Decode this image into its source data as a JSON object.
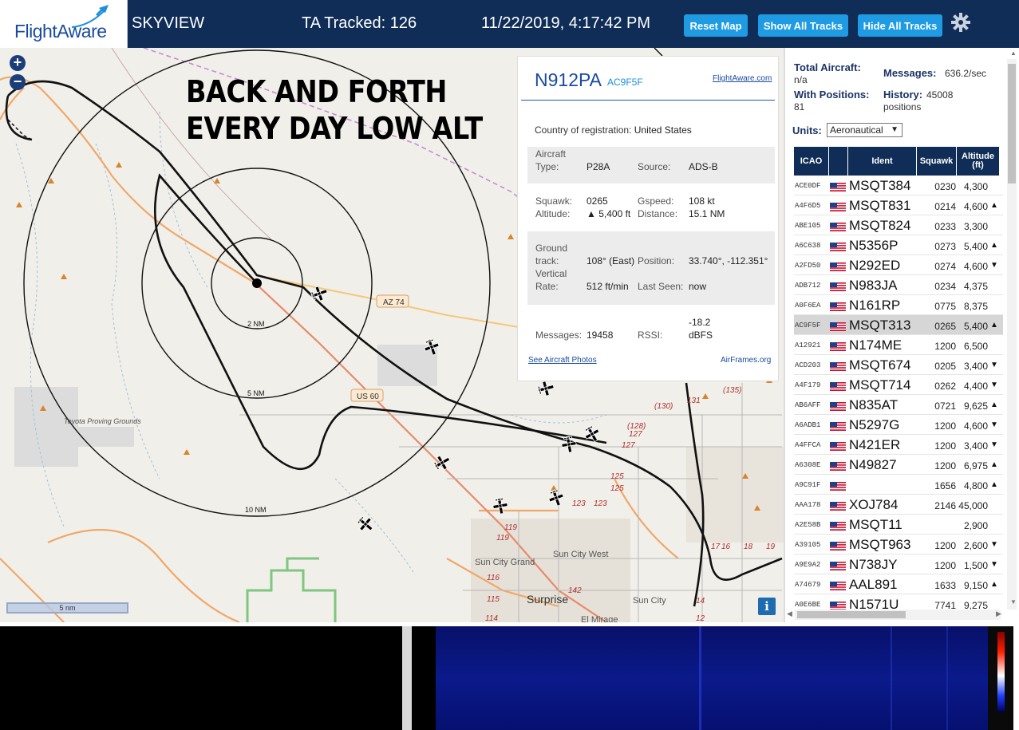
{
  "header": {
    "logo_text": "FlightAware",
    "app_name": "SKYVIEW",
    "tracked": "TA Tracked: 126",
    "datetime": "11/22/2019, 4:17:42 PM",
    "btn_reset": "Reset Map",
    "btn_show": "Show All Tracks",
    "btn_hide": "Hide All Tracks",
    "settings_icon": "gear-icon"
  },
  "map": {
    "overlay_line1": "BACK AND FORTH",
    "overlay_line2": "EVERY DAY LOW ALT",
    "zoom_in": "+",
    "zoom_out": "−",
    "scale_label": "5 nm",
    "info_label": "i",
    "ring_labels": [
      "2 NM",
      "5 NM",
      "10 NM"
    ],
    "road_labels": [
      "AZ 74",
      "US 60"
    ],
    "place_labels": {
      "toyota": "Toyota Proving Grounds",
      "sun_city_grand": "Sun City Grand",
      "sun_city_west": "Sun City West",
      "surprise": "Surprise",
      "sun_city": "Sun City",
      "el_mirage": "El Mirage"
    },
    "route_numbers": [
      "(130)",
      "131",
      "(135)",
      "(128)",
      "127",
      "127",
      "125",
      "125",
      "123",
      "123",
      "119",
      "119",
      "116",
      "115",
      "114",
      "142",
      "17",
      "16",
      "18",
      "19",
      "14",
      "12"
    ]
  },
  "popup": {
    "ident": "N912PA",
    "hex": "AC9F5F",
    "fa_link": "FlightAware.com",
    "country_label": "Country of registration:",
    "country_value": "United States",
    "aircraft_type_label_1": "Aircraft",
    "aircraft_type_label_2": "Type:",
    "aircraft_type": "P28A",
    "source_label": "Source:",
    "source": "ADS-B",
    "squawk_label": "Squawk:",
    "squawk": "0265",
    "gspeed_label": "Gspeed:",
    "gspeed": "108 kt",
    "altitude_label": "Altitude:",
    "altitude": "▲ 5,400 ft",
    "distance_label": "Distance:",
    "distance": "15.1 NM",
    "ground_label_1": "Ground",
    "ground_label_2": "track:",
    "ground_track": "108° (East)",
    "position_label": "Position:",
    "position": "33.740°, -112.351°",
    "vertical_label_1": "Vertical",
    "vertical_label_2": "Rate:",
    "vertical_rate": "512 ft/min",
    "last_seen_label": "Last Seen:",
    "last_seen": "now",
    "messages_label": "Messages:",
    "messages": "19458",
    "rssi_label": "RSSI:",
    "rssi_1": "-18.2",
    "rssi_2": "dBFS",
    "photos_link": "See Aircraft Photos",
    "airframes_link": "AirFrames.org"
  },
  "stats": {
    "total_label": "Total Aircraft:",
    "total_value": "n/a",
    "messages_label": "Messages:",
    "messages_value": "636.2/sec",
    "withpos_label": "With Positions:",
    "withpos_value": "81",
    "history_label": "History:",
    "history_value_1": "45008",
    "history_value_2": "positions",
    "units_label": "Units:",
    "units_value": "Aeronautical"
  },
  "table": {
    "headers": [
      "ICAO",
      "",
      "Ident",
      "Squawk",
      "Altitude (ft)"
    ],
    "rows": [
      {
        "icao": "ACE0DF",
        "ident": "MSQT384",
        "squawk": "0230",
        "alt": "4,300",
        "arrow": ""
      },
      {
        "icao": "A4F6D5",
        "ident": "MSQT831",
        "squawk": "0214",
        "alt": "4,600",
        "arrow": "▲"
      },
      {
        "icao": "ABE105",
        "ident": "MSQT824",
        "squawk": "0233",
        "alt": "3,300",
        "arrow": ""
      },
      {
        "icao": "A6C638",
        "ident": "N5356P",
        "squawk": "0273",
        "alt": "5,400",
        "arrow": "▲"
      },
      {
        "icao": "A2FD50",
        "ident": "N292ED",
        "squawk": "0274",
        "alt": "4,600",
        "arrow": "▼"
      },
      {
        "icao": "ADB712",
        "ident": "N983JA",
        "squawk": "0234",
        "alt": "4,375",
        "arrow": ""
      },
      {
        "icao": "A0F6EA",
        "ident": "N161RP",
        "squawk": "0775",
        "alt": "8,375",
        "arrow": ""
      },
      {
        "icao": "AC9F5F",
        "ident": "MSQT313",
        "squawk": "0265",
        "alt": "5,400",
        "arrow": "▲"
      },
      {
        "icao": "A12921",
        "ident": "N174ME",
        "squawk": "1200",
        "alt": "6,500",
        "arrow": ""
      },
      {
        "icao": "ACD203",
        "ident": "MSQT674",
        "squawk": "0205",
        "alt": "3,400",
        "arrow": "▼"
      },
      {
        "icao": "A4F179",
        "ident": "MSQT714",
        "squawk": "0262",
        "alt": "4,400",
        "arrow": "▼"
      },
      {
        "icao": "AB6AFF",
        "ident": "N835AT",
        "squawk": "0721",
        "alt": "9,625",
        "arrow": "▲"
      },
      {
        "icao": "A6ADB1",
        "ident": "N5297G",
        "squawk": "1200",
        "alt": "4,600",
        "arrow": "▼"
      },
      {
        "icao": "A4FFCA",
        "ident": "N421ER",
        "squawk": "1200",
        "alt": "3,400",
        "arrow": "▼"
      },
      {
        "icao": "A6308E",
        "ident": "N49827",
        "squawk": "1200",
        "alt": "6,975",
        "arrow": "▲"
      },
      {
        "icao": "A9C91F",
        "ident": "",
        "squawk": "1656",
        "alt": "4,800",
        "arrow": "▲"
      },
      {
        "icao": "AAA178",
        "ident": "XOJ784",
        "squawk": "2146",
        "alt": "45,000",
        "arrow": ""
      },
      {
        "icao": "A2E58B",
        "ident": "MSQT11",
        "squawk": "",
        "alt": "2,900",
        "arrow": ""
      },
      {
        "icao": "A39105",
        "ident": "MSQT963",
        "squawk": "1200",
        "alt": "2,600",
        "arrow": "▼"
      },
      {
        "icao": "A9E9A2",
        "ident": "N738JY",
        "squawk": "1200",
        "alt": "1,500",
        "arrow": "▼"
      },
      {
        "icao": "A74679",
        "ident": "AAL891",
        "squawk": "1633",
        "alt": "9,150",
        "arrow": "▲"
      },
      {
        "icao": "A0E6BE",
        "ident": "N1571U",
        "squawk": "7741",
        "alt": "9,275",
        "arrow": ""
      }
    ],
    "selected_icao": "AC9F5F"
  },
  "colors": {
    "header_bg": "#0f2d56",
    "button_bg": "#1e9be2",
    "map_bg": "#f1efe9",
    "selected_row": "#d6d6d6"
  }
}
